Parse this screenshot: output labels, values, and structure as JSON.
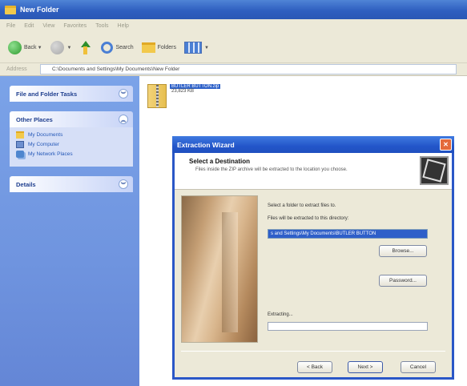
{
  "window": {
    "title": "New Folder"
  },
  "menubar": {
    "items": [
      "File",
      "Edit",
      "View",
      "Favorites",
      "Tools",
      "Help"
    ]
  },
  "toolbar": {
    "back_label": "Back",
    "search_label": "Search",
    "folders_label": "Folders"
  },
  "address": {
    "label": "Address",
    "value": "C:\\Documents and Settings\\My Documents\\New Folder"
  },
  "taskpane": {
    "file_tasks": {
      "title": "File and Folder Tasks"
    },
    "other_places": {
      "title": "Other Places",
      "items": [
        "My Documents",
        "My Computer",
        "My Network Places"
      ]
    },
    "details": {
      "title": "Details"
    }
  },
  "files": [
    {
      "name": "BUTLER BUTTON.zip",
      "size": "23,823 KB"
    }
  ],
  "wizard": {
    "title": "Extraction Wizard",
    "heading": "Select a Destination",
    "description": "Files inside the ZIP archive will be extracted to the location you choose.",
    "select_label": "Select a folder to extract files to.",
    "dir_label": "Files will be extracted to this directory:",
    "destination": "s and Settings\\My Documents\\BUTLER BUTTON",
    "browse_label": "Browse...",
    "password_label": "Password...",
    "extracting_label": "Extracting...",
    "progress": 0,
    "back_label": "< Back",
    "next_label": "Next >",
    "cancel_label": "Cancel",
    "close_glyph": "✕"
  }
}
